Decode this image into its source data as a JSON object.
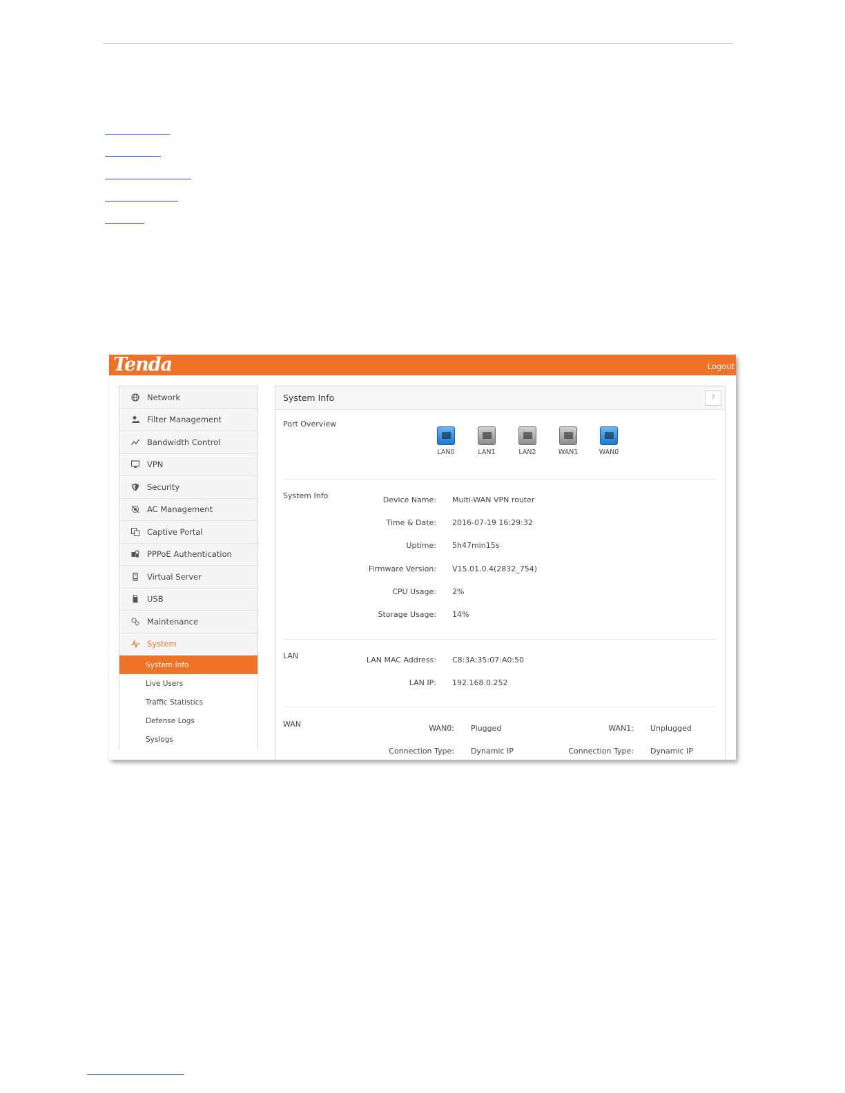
{
  "header": {
    "logo": "Tenda",
    "logout": "Logout"
  },
  "sidebar": {
    "items": [
      {
        "label": "Network"
      },
      {
        "label": "Filter Management"
      },
      {
        "label": "Bandwidth Control"
      },
      {
        "label": "VPN"
      },
      {
        "label": "Security"
      },
      {
        "label": "AC Management"
      },
      {
        "label": "Captive Portal"
      },
      {
        "label": "PPPoE Authentication"
      },
      {
        "label": "Virtual Server"
      },
      {
        "label": "USB"
      },
      {
        "label": "Maintenance"
      },
      {
        "label": "System"
      }
    ],
    "subitems": [
      {
        "label": "System Info"
      },
      {
        "label": "Live Users"
      },
      {
        "label": "Traffic Statistics"
      },
      {
        "label": "Defense Logs"
      },
      {
        "label": "Syslogs"
      }
    ],
    "accent_color": "#ee7228"
  },
  "panel": {
    "title": "System Info",
    "help": "?",
    "port_overview": {
      "label": "Port Overview",
      "ports": [
        {
          "name": "LAN0",
          "state": "connected"
        },
        {
          "name": "LAN1",
          "state": "disconnected"
        },
        {
          "name": "LAN2",
          "state": "disconnected"
        },
        {
          "name": "WAN1",
          "state": "disconnected"
        },
        {
          "name": "WAN0",
          "state": "connected"
        }
      ]
    },
    "system_info": {
      "label": "System Info",
      "rows": [
        {
          "label": "Device Name:",
          "value": "Multi-WAN VPN router"
        },
        {
          "label": "Time & Date:",
          "value": "2016-07-19 16:29:32"
        },
        {
          "label": "Uptime:",
          "value": "5h47min15s"
        },
        {
          "label": "Firmware Version:",
          "value": "V15.01.0.4(2832_754)"
        },
        {
          "label": "CPU Usage:",
          "value": "2%"
        },
        {
          "label": "Storage Usage:",
          "value": "14%"
        }
      ]
    },
    "lan": {
      "label": "LAN",
      "rows": [
        {
          "label": "LAN MAC Address:",
          "value": "C8:3A:35:07:A0:50"
        },
        {
          "label": "LAN IP:",
          "value": "192.168.0.252"
        }
      ]
    },
    "wan": {
      "label": "WAN",
      "wan0": {
        "label": "WAN0:",
        "value": "Plugged",
        "conn_label": "Connection Type:",
        "conn_value": "Dynamic IP"
      },
      "wan1": {
        "label": "WAN1:",
        "value": "Unplugged",
        "conn_label": "Connection Type:",
        "conn_value": "Dynamic IP"
      }
    }
  }
}
